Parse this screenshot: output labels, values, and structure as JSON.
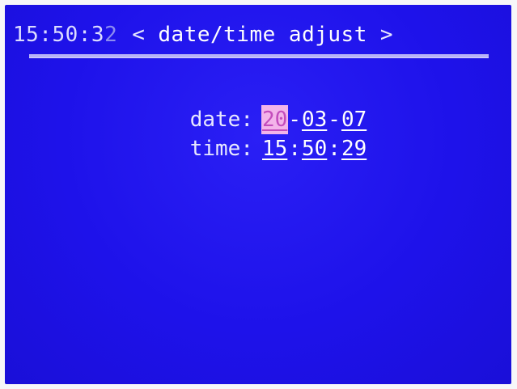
{
  "header": {
    "clock_main": "15:50:3",
    "clock_last_digit": "2",
    "nav_left": "<",
    "title": "date/time adjust",
    "nav_right": ">"
  },
  "fields": {
    "date": {
      "label": "date:",
      "year": "20",
      "month": "03",
      "day": "07",
      "separator": "-",
      "selected_segment": "year"
    },
    "time": {
      "label": "time:",
      "hour": "15",
      "minute": "50",
      "second": "29",
      "separator": ":"
    }
  },
  "colors": {
    "screen_background": "#1f14ee",
    "selection_highlight": "#f3b4ea",
    "selection_text": "#c34cbc",
    "divider": "#b7b3f7"
  }
}
